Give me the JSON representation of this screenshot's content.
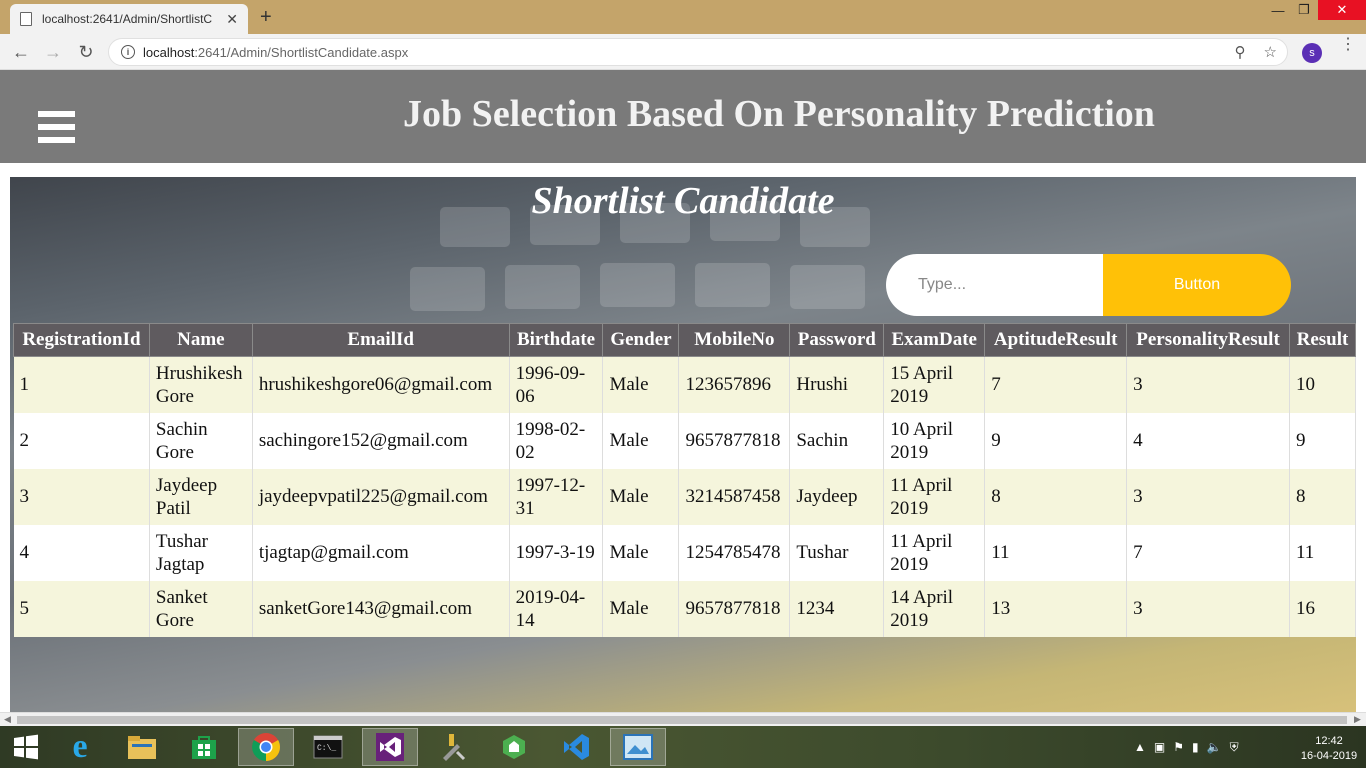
{
  "browser": {
    "tab_title": "localhost:2641/Admin/ShortlistC",
    "tab_close": "✕",
    "new_tab": "+",
    "url_host": "localhost",
    "url_rest": ":2641/Admin/ShortlistCandidate.aspx",
    "profile_initial": "s"
  },
  "header": {
    "title": "Job Selection Based On Personality Prediction"
  },
  "main": {
    "section_title": "Shortlist Candidate",
    "search": {
      "placeholder": "Type...",
      "button_label": "Button"
    },
    "table": {
      "columns": [
        "RegistrationId",
        "Name",
        "EmailId",
        "Birthdate",
        "Gender",
        "MobileNo",
        "Password",
        "ExamDate",
        "AptitudeResult",
        "PersonalityResult",
        "Result"
      ],
      "rows": [
        [
          "1",
          "Hrushikesh Gore",
          "hrushikeshgore06@gmail.com",
          "1996-09-06",
          "Male",
          "123657896",
          "Hrushi",
          "15 April 2019",
          "7",
          "3",
          "10"
        ],
        [
          "2",
          "Sachin Gore",
          "sachingore152@gmail.com",
          "1998-02-02",
          "Male",
          "9657877818",
          "Sachin",
          "10 April 2019",
          "9",
          "4",
          "9"
        ],
        [
          "3",
          "Jaydeep Patil",
          "jaydeepvpatil225@gmail.com",
          "1997-12-31",
          "Male",
          "3214587458",
          "Jaydeep",
          "11 April 2019",
          "8",
          "3",
          "8"
        ],
        [
          "4",
          "Tushar Jagtap",
          "tjagtap@gmail.com",
          "1997-3-19",
          "Male",
          "1254785478",
          "Tushar",
          "11 April 2019",
          "11",
          "7",
          "11"
        ],
        [
          "5",
          "Sanket Gore",
          "sanketGore143@gmail.com",
          "2019-04-14",
          "Male",
          "9657877818",
          "1234",
          "14 April 2019",
          "13",
          "3",
          "16"
        ]
      ]
    }
  },
  "taskbar": {
    "time": "12:42",
    "date": "16-04-2019",
    "apps": [
      "start-icon",
      "internet-explorer-icon",
      "file-explorer-icon",
      "store-icon",
      "chrome-icon",
      "terminal-icon",
      "visual-studio-icon",
      "tools-icon",
      "android-studio-icon",
      "vscode-icon",
      "photos-icon"
    ]
  },
  "colors": {
    "header_bg": "#7a7a7a",
    "table_header_bg": "#5f5b5f",
    "row_odd": "#f5f5dc",
    "button_bg": "#ffc107"
  }
}
